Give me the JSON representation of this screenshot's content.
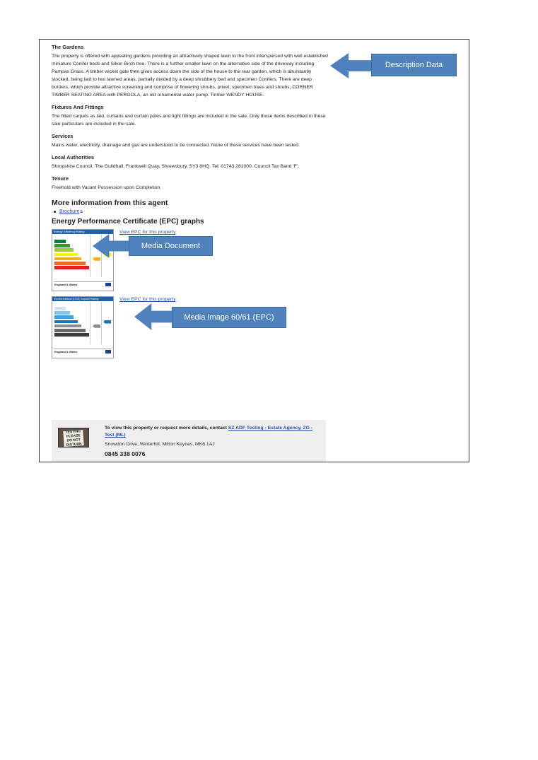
{
  "sections": [
    {
      "title": "The Gardens",
      "body": "The property is offered with appealing gardens providing an attractively shaped lawn to the front interspersed with well established miniature Conifer beds and Silver Birch tree. There is a further smaller lawn on the alternative side of the driveway including Pampas Grass. A timber wicket gate then gives access down the side of the house to the rear garden, which is abundantly stocked, being laid to two lawned areas, partially divided by a deep shrubbery bed and specimen Conifers. There are deep borders, which provide attractive screening and comprise of flowering shrubs, privet, specimen trees and shrubs, CORNER TIMBER SEATING AREA with PERGOLA, an old ornamental water pump. Timber WENDY HOUSE."
    },
    {
      "title": "Fixtures And Fittings",
      "body": "The fitted carpets as laid, curtains and curtain poles and light fittings are included in the sale. Only those items described in these sale particulars are included in the sale."
    },
    {
      "title": "Services",
      "body": "Mains water, electricity, drainage and gas are understood to be connected. None of these services have been tested."
    },
    {
      "title": "Local Authorities",
      "body": "Shropshire Council, The Guildhall, Frankwell Quay, Shrewsbury, SY3 8HQ. Tel: 01743 281000. Council Tax Band 'F'."
    },
    {
      "title": "Tenure",
      "body": "Freehold with Vacant Possession upon Completion."
    }
  ],
  "more_info": {
    "title": "More information from this agent",
    "brochure_label": "Brochure"
  },
  "epc": {
    "title": "Energy Performance Certificate (EPC) graphs",
    "link_label": "View EPC for this property",
    "energy_card_title": "Energy Efficiency Rating",
    "impact_card_title": "Environmental (CO2) Impact Rating",
    "footer_label": "England & Wales",
    "energy_colors": [
      "#007f3d",
      "#2c9f29",
      "#9dcb3c",
      "#fff200",
      "#f7af1d",
      "#ed6823",
      "#e31d23"
    ],
    "impact_colors": [
      "#cfe3f5",
      "#8fc1e8",
      "#3ea2dc",
      "#1f72b8",
      "#8c8c8c",
      "#6a6a6a",
      "#3c3c3c"
    ]
  },
  "contact": {
    "intro": "To view this property or request more details, contact",
    "agent_link": "SZ ADF Testing - Estate Agency, ZG - Test (ML)",
    "address": "Snowdon Drive, Winterhill, Milton Keynes, MK6 1AJ",
    "phone": "0845 338 0076",
    "photo_text": "TESTING PLEASE DO NOT DISTURB"
  },
  "callouts": {
    "description": "Description Data",
    "document": "Media Document",
    "image": "Media Image 60/61 (EPC)"
  }
}
